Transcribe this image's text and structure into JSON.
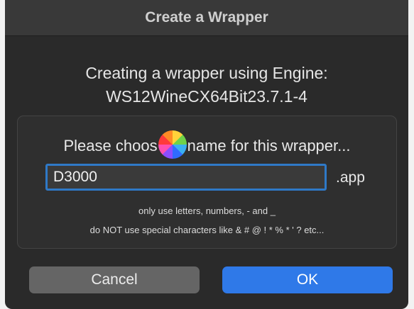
{
  "dialog": {
    "title": "Create a Wrapper",
    "heading_line1": "Creating a wrapper using Engine:",
    "heading_line2": "WS12WineCX64Bit23.7.1-4",
    "prompt_before": "Please choos",
    "prompt_after": "name for this wrapper...",
    "name_value": "D3000",
    "name_suffix": ".app",
    "hint_line1": "only use letters, numbers, - and _",
    "hint_line2": "do NOT use special characters like & # @ ! * % * ' ? etc...",
    "cancel_label": "Cancel",
    "ok_label": "OK"
  },
  "icons": {
    "busy": "spinning-wheel-icon"
  },
  "colors": {
    "accent": "#2f79e8",
    "input_focus": "#2f79c7"
  }
}
